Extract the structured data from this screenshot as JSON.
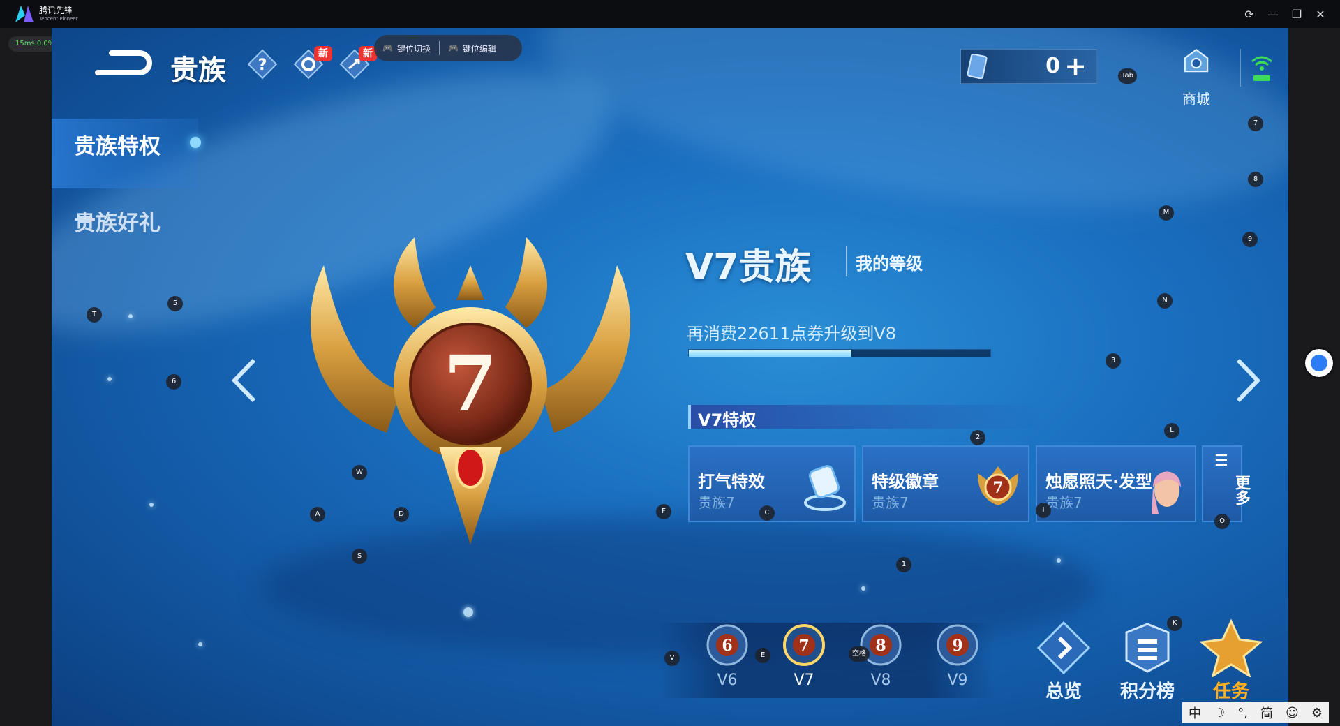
{
  "app": {
    "name": "腾讯先锋",
    "name_sub": "Tencent Pioneer",
    "ping": "15ms 0.0%"
  },
  "window_controls": [
    "refresh-icon",
    "minimize-icon",
    "restore-icon",
    "close-icon"
  ],
  "header": {
    "title": "贵族",
    "new_badge_1": "新",
    "new_badge_2": "新",
    "keymap_switch": "键位切换",
    "keymap_edit": "键位编辑",
    "currency_value": "0",
    "currency_plus": "+",
    "tab_hint": "Tab",
    "shop_label": "商城"
  },
  "nav": {
    "items": [
      {
        "label": "贵族特权",
        "active": true
      },
      {
        "label": "贵族好礼",
        "active": false
      }
    ]
  },
  "emblem": {
    "level": "7"
  },
  "info": {
    "vip_title": "V7贵族",
    "my_level": "我的等级",
    "upgrade_text": "再消费22611点券升级到V8",
    "progress": 0.54,
    "privilege_header": "V7特权"
  },
  "cards": [
    {
      "title": "打气特效",
      "sub": "贵族7",
      "icon": "fist-effect-icon"
    },
    {
      "title": "特级徽章",
      "sub": "贵族7",
      "icon": "badge-icon"
    },
    {
      "title": "烛愿照天·发型",
      "sub": "贵族7",
      "icon": "hairstyle-icon"
    }
  ],
  "more_label": "更多",
  "levels": [
    {
      "num": "6",
      "label": "V6",
      "selected": false
    },
    {
      "num": "7",
      "label": "V7",
      "selected": true
    },
    {
      "num": "8",
      "label": "V8",
      "selected": false
    },
    {
      "num": "9",
      "label": "V9",
      "selected": false
    }
  ],
  "bottom_buttons": [
    {
      "label": "总览",
      "color": "#e8f4ff"
    },
    {
      "label": "积分榜",
      "color": "#e8f4ff"
    },
    {
      "label": "任务",
      "color": "#ffb020"
    }
  ],
  "key_hints": [
    "7",
    "8",
    "M",
    "9",
    "N",
    "3",
    "L",
    "2",
    "T",
    "5",
    "6",
    "W",
    "A",
    "D",
    "S",
    "F",
    "C",
    "I",
    "O",
    "1",
    "K",
    "V",
    "E",
    "空格"
  ],
  "ime": [
    "中",
    "☽",
    "°,",
    "简",
    "☺",
    "⚙"
  ],
  "colors": {
    "accent": "#2a8ed6",
    "task": "#ffb020",
    "badge_new": "#e33333"
  }
}
